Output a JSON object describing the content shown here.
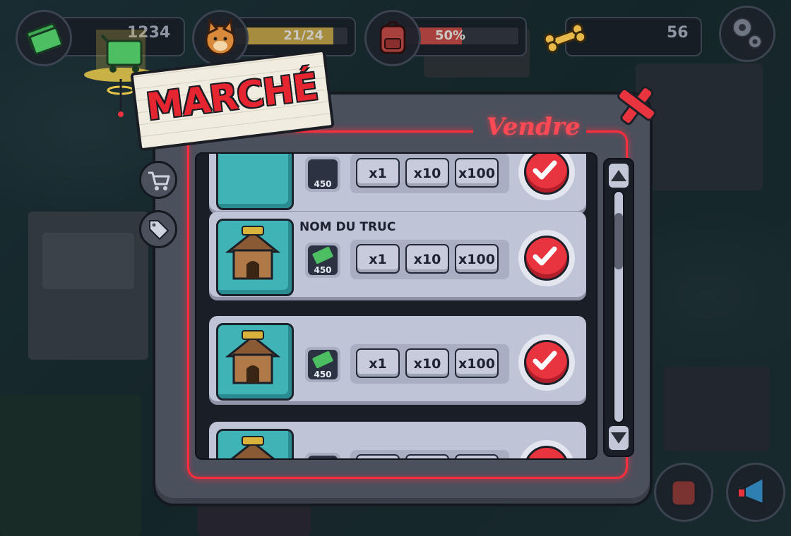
{
  "hud": {
    "money": "1234",
    "population": "21/24",
    "population_fraction": 0.875,
    "storage": "50%",
    "storage_fraction": 0.5,
    "bones": "56"
  },
  "dialog": {
    "title": "MARCHÉ",
    "section_title": "Vendre",
    "items": [
      {
        "name": "",
        "price": "450",
        "qty_options": [
          "x1",
          "x10",
          "x100"
        ]
      },
      {
        "name": "NOM DU TRUC",
        "price": "450",
        "qty_options": [
          "x1",
          "x10",
          "x100"
        ]
      },
      {
        "name": "",
        "price": "450",
        "qty_options": [
          "x1",
          "x10",
          "x100"
        ]
      },
      {
        "name": "",
        "price": "",
        "qty_options": [
          "",
          "",
          ""
        ]
      }
    ]
  },
  "scroll": {
    "position": 0.12
  },
  "colors": {
    "accent": "#ff2d3d",
    "confirm": "#e8343f",
    "panel": "#4b505d",
    "row": "#bfc4d6",
    "thumbnail": "#3fb3b6",
    "money_green": "#3fa852",
    "population_fill": "#a58c3e",
    "storage_fill": "#a8403e"
  },
  "icons": {
    "money": "cash-icon",
    "population": "dog-icon",
    "storage": "backpack-icon",
    "bones": "bone-icon",
    "settings": "gear-icon",
    "shop_tab": "cart-icon",
    "sell_tab": "price-tag-icon",
    "close": "close-icon",
    "confirm": "checkmark-icon",
    "item": "doghouse-icon",
    "market": "shopping-basket-icon"
  }
}
